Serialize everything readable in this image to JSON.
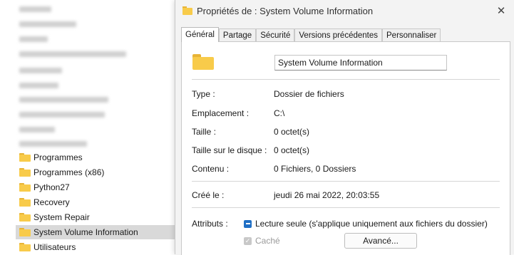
{
  "explorer": {
    "items": [
      {
        "label": "Programmes"
      },
      {
        "label": "Programmes (x86)"
      },
      {
        "label": "Python27"
      },
      {
        "label": "Recovery"
      },
      {
        "label": "System Repair"
      },
      {
        "label": "System Volume Information",
        "selected": true
      },
      {
        "label": "Utilisateurs"
      }
    ]
  },
  "dialog": {
    "title": "Propriétés de : System Volume Information",
    "close_glyph": "✕",
    "tabs": [
      {
        "label": "Général",
        "active": true
      },
      {
        "label": "Partage"
      },
      {
        "label": "Sécurité"
      },
      {
        "label": "Versions précédentes"
      },
      {
        "label": "Personnaliser"
      }
    ],
    "general": {
      "name_value": "System Volume Information",
      "props": [
        {
          "label": "Type :",
          "value": "Dossier de fichiers"
        },
        {
          "label": "Emplacement :",
          "value": "C:\\"
        },
        {
          "label": "Taille :",
          "value": "0 octet(s)"
        },
        {
          "label": "Taille sur le disque :",
          "value": "0 octet(s)"
        },
        {
          "label": "Contenu :",
          "value": "0 Fichiers, 0 Dossiers"
        }
      ],
      "created_label": "Créé le :",
      "created_value": "jeudi 26 mai 2022, 20:03:55",
      "attributes_label": "Attributs :",
      "readonly_label": "Lecture seule (s'applique uniquement aux fichiers du dossier)",
      "hidden_label": "Caché",
      "advanced_button": "Avancé..."
    }
  },
  "colors": {
    "folder": "#f8cb4a",
    "accent": "#1f6fc5",
    "selection": "#d9d9d9"
  }
}
